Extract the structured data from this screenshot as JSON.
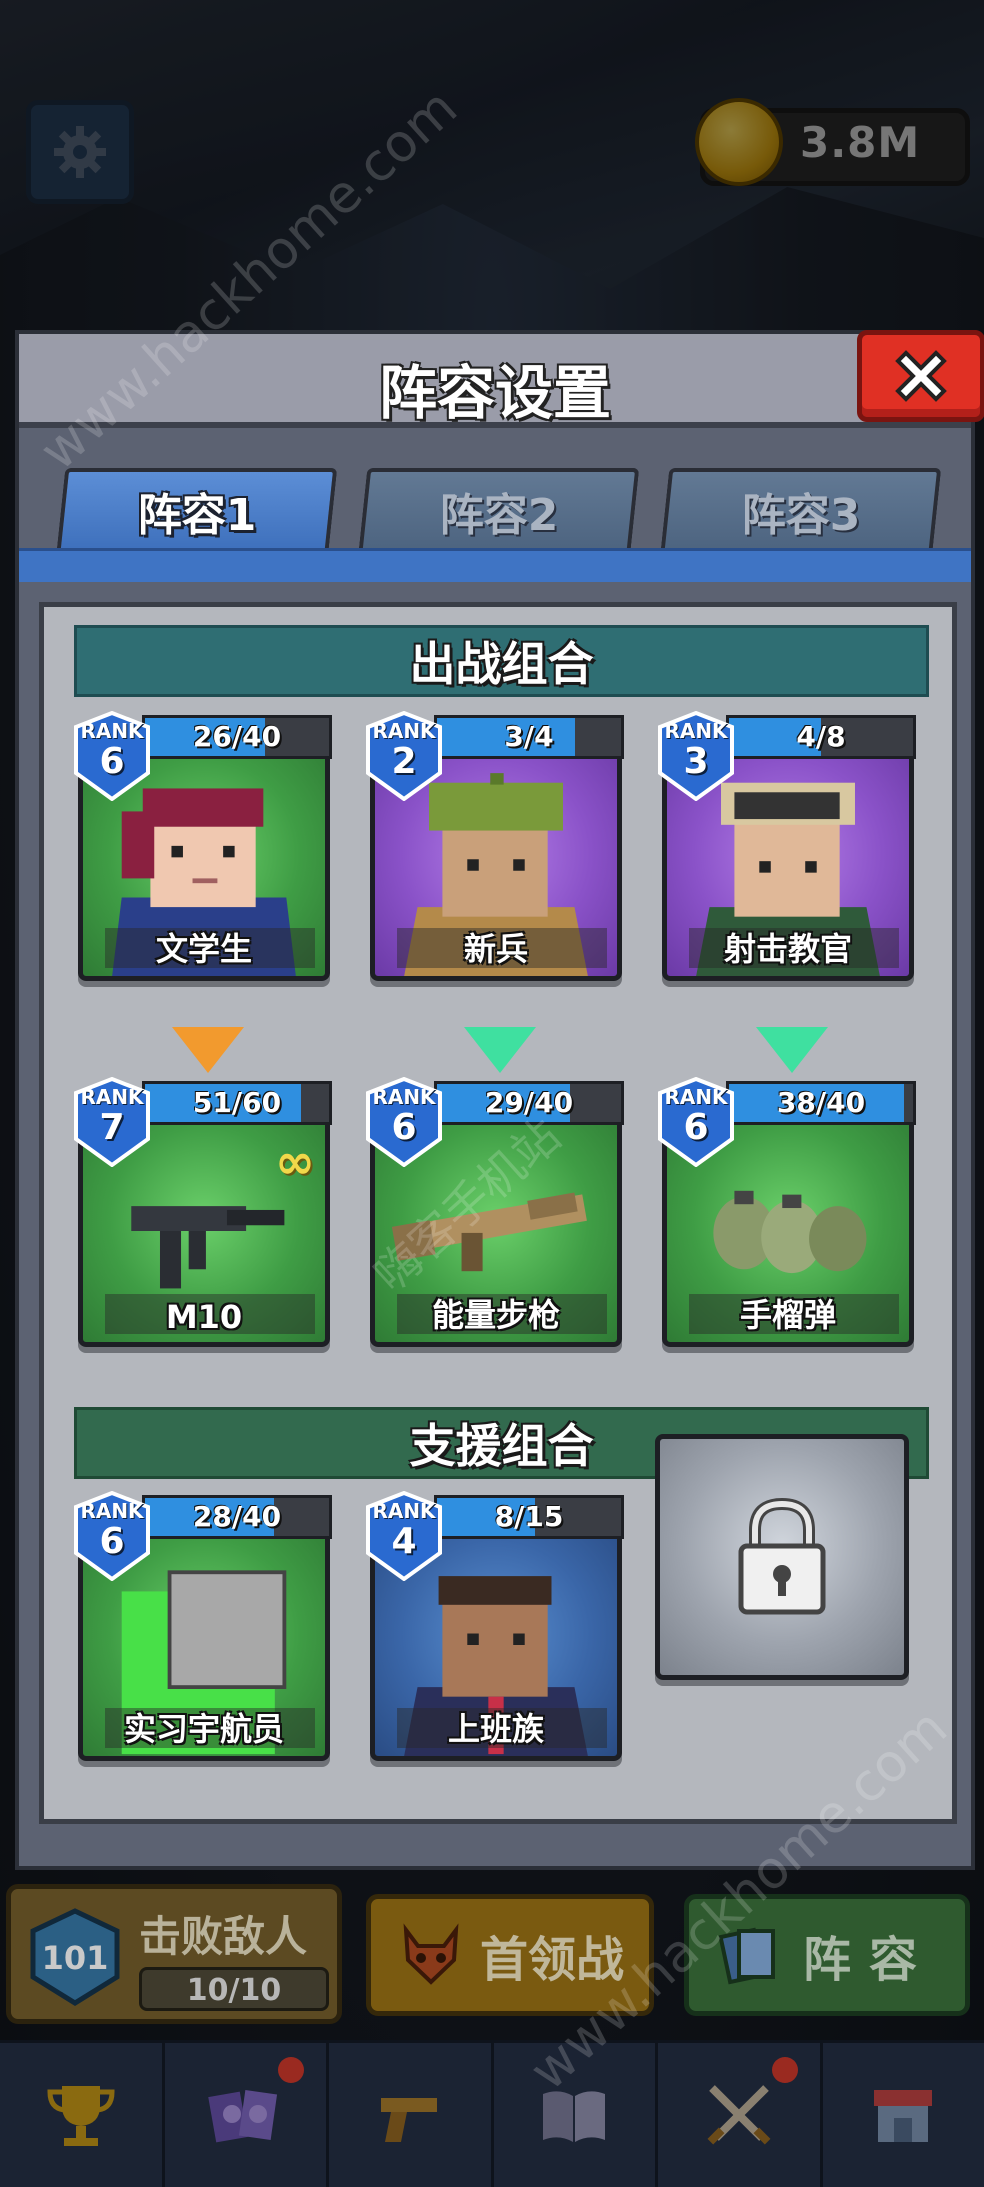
{
  "top_hud": {
    "settings_icon": "gear-icon",
    "coin_icon": "gold-coin-icon",
    "coins": "3.8M"
  },
  "modal": {
    "title": "阵容设置",
    "close_icon": "close-x-icon",
    "tabs": [
      {
        "label": "阵容1",
        "active": true
      },
      {
        "label": "阵容2",
        "active": false
      },
      {
        "label": "阵容3",
        "active": false
      }
    ]
  },
  "battle_section": {
    "title": "出战组合",
    "characters": [
      {
        "name": "文学生",
        "rank_label": "RANK",
        "rank": "6",
        "progress": "26/40",
        "fill": 0.65,
        "bg": "green"
      },
      {
        "name": "新兵",
        "rank_label": "RANK",
        "rank": "2",
        "progress": "3/4",
        "fill": 0.75,
        "bg": "purple"
      },
      {
        "name": "射击教官",
        "rank_label": "RANK",
        "rank": "3",
        "progress": "4/8",
        "fill": 0.5,
        "bg": "purple"
      }
    ],
    "arrows": [
      "orange",
      "green",
      "green"
    ],
    "weapons": [
      {
        "name": "M10",
        "rank_label": "RANK",
        "rank": "7",
        "progress": "51/60",
        "fill": 0.85,
        "bg": "green",
        "badge": "∞"
      },
      {
        "name": "能量步枪",
        "rank_label": "RANK",
        "rank": "6",
        "progress": "29/40",
        "fill": 0.725,
        "bg": "green"
      },
      {
        "name": "手榴弹",
        "rank_label": "RANK",
        "rank": "6",
        "progress": "38/40",
        "fill": 0.95,
        "bg": "green"
      }
    ]
  },
  "support_section": {
    "title": "支援组合",
    "characters": [
      {
        "name": "实习宇航员",
        "rank_label": "RANK",
        "rank": "6",
        "progress": "28/40",
        "fill": 0.7,
        "bg": "green"
      },
      {
        "name": "上班族",
        "rank_label": "RANK",
        "rank": "4",
        "progress": "8/15",
        "fill": 0.53,
        "bg": "blue"
      }
    ],
    "locked_icon": "padlock-icon"
  },
  "bottom_panel": {
    "level": "101",
    "kill_title": "击败敌人",
    "kill_count": "10/10",
    "boss_label": "首领战",
    "lineup_label": "阵容"
  },
  "nav": [
    "trophy-icon",
    "heroes-icon",
    "pistol-icon",
    "book-icon",
    "crossed-swords-icon",
    "shop-icon"
  ],
  "watermark": [
    "www.hackhome.com",
    "嗨客手机站"
  ],
  "colors": {
    "tab_active": "#3e70bc",
    "close_red": "#e03024",
    "section_header": "#2f6e73",
    "progress_fill": "#2f8fe0"
  }
}
